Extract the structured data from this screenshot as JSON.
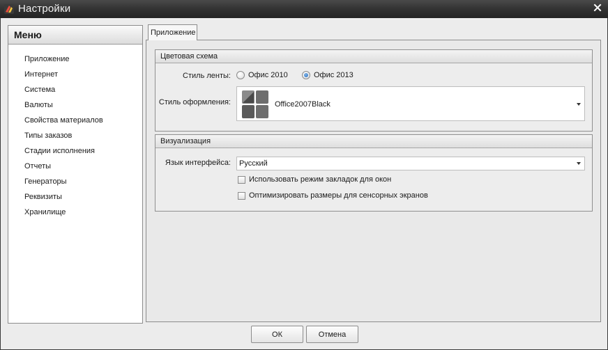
{
  "window": {
    "title": "Настройки",
    "close_symbol": "×"
  },
  "menu": {
    "header": "Меню",
    "items": [
      {
        "label": "Приложение"
      },
      {
        "label": "Интернет"
      },
      {
        "label": "Система"
      },
      {
        "label": "Валюты"
      },
      {
        "label": "Свойства материалов"
      },
      {
        "label": "Типы заказов"
      },
      {
        "label": "Стадии исполнения"
      },
      {
        "label": "Отчеты"
      },
      {
        "label": "Генераторы"
      },
      {
        "label": "Реквизиты"
      },
      {
        "label": "Хранилище"
      }
    ]
  },
  "tabs": [
    {
      "label": "Приложение",
      "active": true
    }
  ],
  "color_scheme": {
    "header": "Цветовая схема",
    "ribbon_style_label": "Стиль ленты:",
    "ribbon_options": [
      {
        "label": "Офис 2010",
        "checked": false
      },
      {
        "label": "Офис 2013",
        "checked": true
      }
    ],
    "skin_label": "Стиль оформления:",
    "skin_value": "Office2007Black"
  },
  "visualization": {
    "header": "Визуализация",
    "language_label": "Язык интерфейса:",
    "language_value": "Русский",
    "checkboxes": [
      {
        "label": "Использовать режим закладок для окон",
        "checked": false
      },
      {
        "label": "Оптимизировать размеры для сенсорных экранов",
        "checked": false
      }
    ]
  },
  "buttons": {
    "ok": "ОК",
    "cancel": "Отмена"
  },
  "icons": {
    "app": "app-logo-icon",
    "close": "close-icon",
    "skin": "skin-tiles-icon",
    "dropdown": "chevron-down-icon"
  },
  "colors": {
    "titlebar": "#2e2e2e",
    "accent_radio": "#2a6fbf",
    "panel_bg": "#ececec"
  }
}
